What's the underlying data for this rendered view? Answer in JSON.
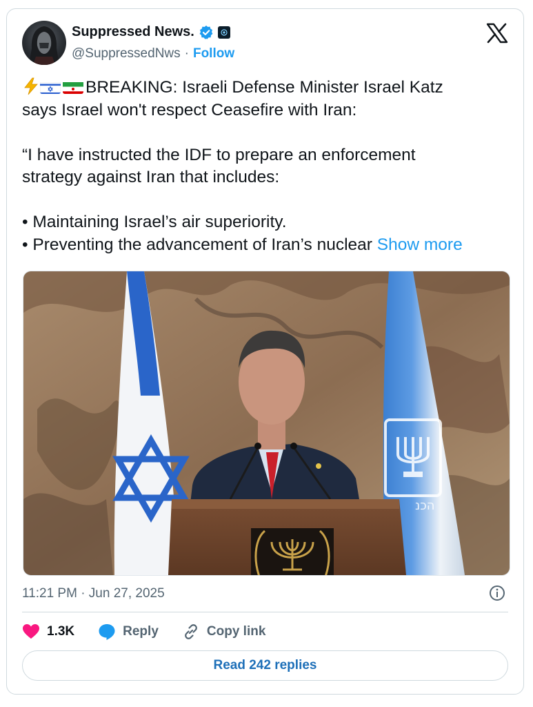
{
  "author": {
    "name": "Suppressed News.",
    "handle": "@SuppressedNws",
    "separator": "·",
    "follow_label": "Follow"
  },
  "tweet": {
    "lines": [
      "BREAKING: Israeli Defense Minister Israel Katz",
      "says Israel won't respect Ceasefire with Iran:",
      "“I have instructed the IDF to prepare an enforcement",
      "strategy against Iran that includes:",
      "• Maintaining Israel’s air superiority.",
      "• Preventing the advancement of Iran’s nuclear"
    ],
    "show_more_label": "Show more"
  },
  "media": {
    "image_semantic": "photo-speaker-at-podium-with-flags",
    "podium_text": "הכנ"
  },
  "meta": {
    "timestamp": "11:21 PM · Jun 27, 2025"
  },
  "actions": {
    "likes_count": "1.3K",
    "reply_label": "Reply",
    "copy_link_label": "Copy link"
  },
  "replies_button_label": "Read 242 replies",
  "colors": {
    "accent": "#1d9bf0",
    "like": "#f91880",
    "text": "#0f1419",
    "muted": "#536471",
    "border": "#cfd9de"
  },
  "icons": [
    "verified-badge-icon",
    "affiliate-badge-icon",
    "x-logo-icon",
    "lightning-emoji-icon",
    "israel-flag-icon",
    "iran-flag-icon",
    "info-icon",
    "heart-icon",
    "reply-bubble-icon",
    "link-icon"
  ]
}
